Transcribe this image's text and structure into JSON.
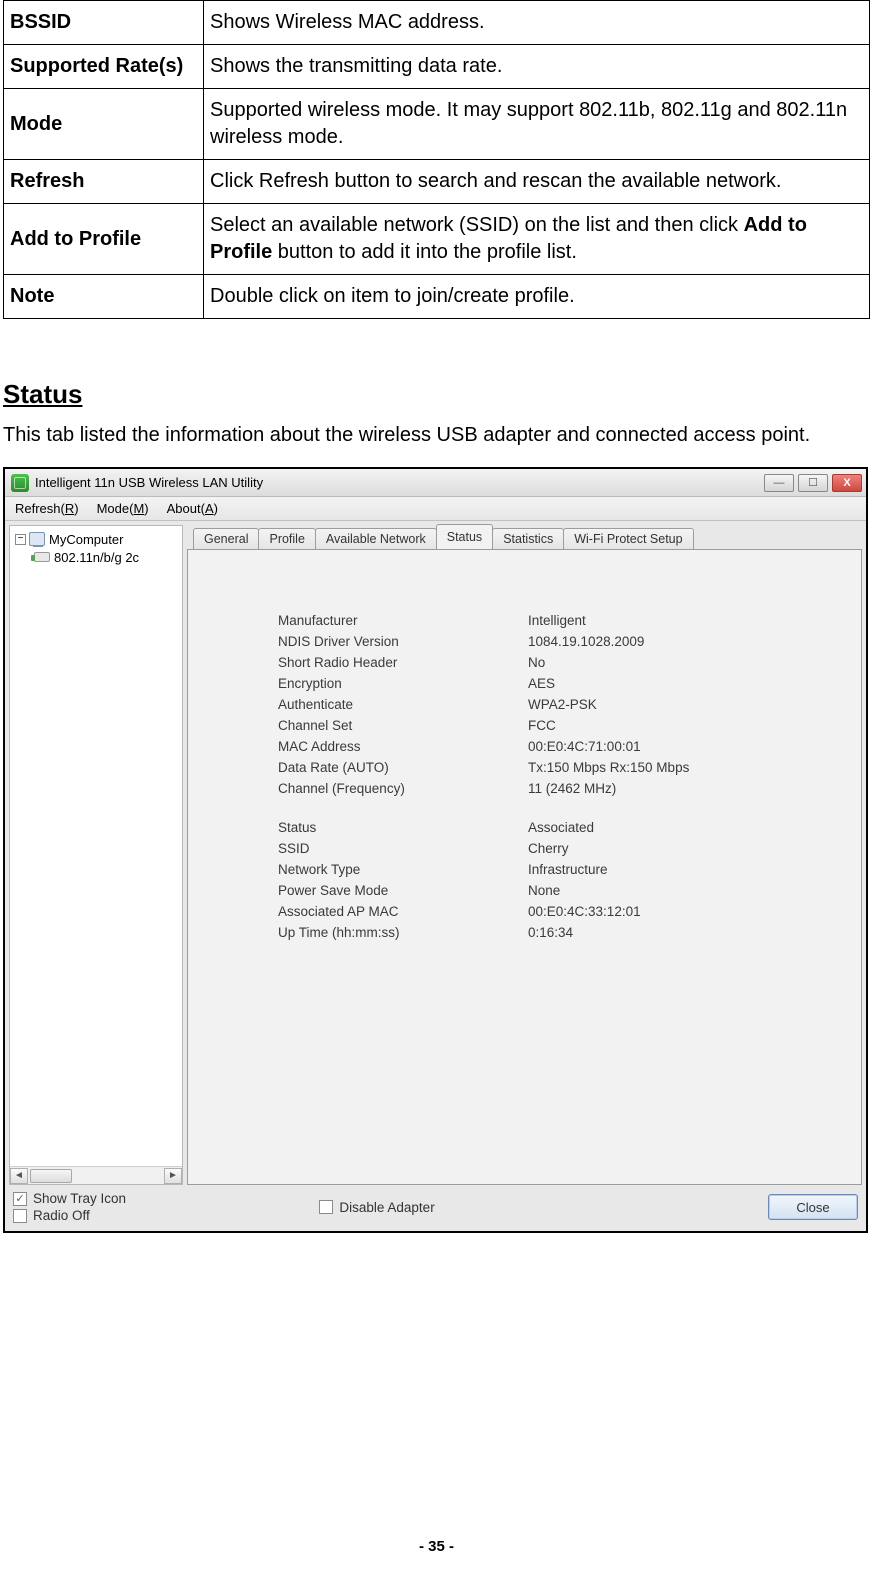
{
  "def_table": [
    {
      "label": "BSSID",
      "desc": "Shows Wireless MAC address."
    },
    {
      "label": "Supported Rate(s)",
      "desc": "Shows the transmitting data rate."
    },
    {
      "label": "Mode",
      "desc": "Supported wireless mode. It may support 802.11b, 802.11g and 802.11n wireless mode."
    },
    {
      "label": "Refresh",
      "desc": "Click Refresh button to search and rescan the available network."
    },
    {
      "label": "Add to Profile",
      "desc_pre": "Select an available network (SSID) on the list and then click ",
      "desc_bold": "Add to Profile",
      "desc_post": " button to add it into the profile list."
    },
    {
      "label": "Note",
      "desc": "Double click on item to join/create profile."
    }
  ],
  "section": {
    "heading": "Status",
    "intro": "This tab listed the information about the wireless USB adapter and connected access point."
  },
  "window": {
    "title": "Intelligent 11n USB Wireless LAN Utility",
    "menubar": [
      {
        "pre": "Refresh(",
        "accel": "R",
        "post": ")"
      },
      {
        "pre": "Mode(",
        "accel": "M",
        "post": ")"
      },
      {
        "pre": "About(",
        "accel": "A",
        "post": ")"
      }
    ],
    "tree": {
      "root": "MyComputer",
      "child": "802.11n/b/g 2c"
    },
    "tabs": [
      "General",
      "Profile",
      "Available Network",
      "Status",
      "Statistics",
      "Wi-Fi Protect Setup"
    ],
    "active_tab": "Status",
    "status_rows": [
      {
        "k": "Manufacturer",
        "v": "Intelligent"
      },
      {
        "k": "NDIS Driver Version",
        "v": "1084.19.1028.2009"
      },
      {
        "k": "Short Radio Header",
        "v": "No"
      },
      {
        "k": "Encryption",
        "v": "AES"
      },
      {
        "k": "Authenticate",
        "v": "WPA2-PSK"
      },
      {
        "k": "Channel Set",
        "v": "FCC"
      },
      {
        "k": "MAC Address",
        "v": "00:E0:4C:71:00:01"
      },
      {
        "k": "Data Rate (AUTO)",
        "v": "Tx:150 Mbps Rx:150 Mbps"
      },
      {
        "k": "Channel (Frequency)",
        "v": "11 (2462 MHz)"
      }
    ],
    "status_rows2": [
      {
        "k": "Status",
        "v": "Associated"
      },
      {
        "k": "SSID",
        "v": "Cherry"
      },
      {
        "k": "Network Type",
        "v": "Infrastructure"
      },
      {
        "k": "Power Save Mode",
        "v": "None"
      },
      {
        "k": "Associated AP MAC",
        "v": "00:E0:4C:33:12:01"
      },
      {
        "k": "Up Time (hh:mm:ss)",
        "v": "0:16:34"
      }
    ],
    "checkboxes": {
      "show_tray": {
        "label": "Show Tray Icon",
        "checked": true
      },
      "radio_off": {
        "label": "Radio Off",
        "checked": false
      },
      "disable_adapter": {
        "label": "Disable Adapter",
        "checked": false
      }
    },
    "close_button": "Close",
    "win_buttons": {
      "min": "—",
      "max": "☐",
      "close": "X"
    }
  },
  "page_number": "- 35 -"
}
